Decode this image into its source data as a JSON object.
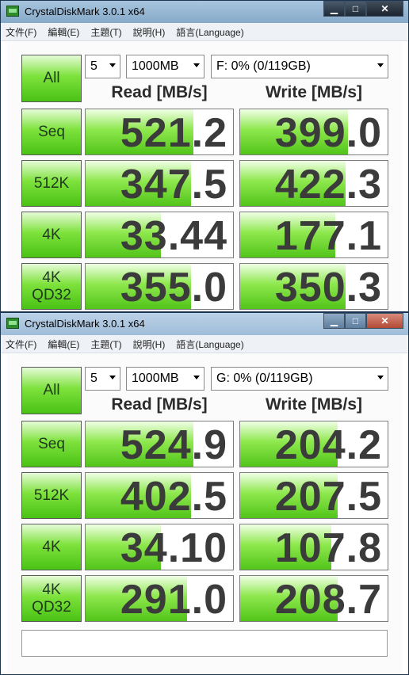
{
  "windows": [
    {
      "title": "CrystalDiskMark 3.0.1 x64",
      "menu": [
        "文件(F)",
        "編輯(E)",
        "主題(T)",
        "說明(H)",
        "語言(Language)"
      ],
      "all_label": "All",
      "count": "5",
      "size": "1000MB",
      "drive": "F: 0% (0/119GB)",
      "read_header": "Read [MB/s]",
      "write_header": "Write [MB/s]",
      "rows": [
        {
          "label": "Seq",
          "label2": "",
          "read": "521.2",
          "write": "399.0"
        },
        {
          "label": "512K",
          "label2": "",
          "read": "347.5",
          "write": "422.3"
        },
        {
          "label": "4K",
          "label2": "",
          "read": "33.44",
          "write": "177.1"
        },
        {
          "label": "4K",
          "label2": "QD32",
          "read": "355.0",
          "write": "350.3"
        }
      ]
    },
    {
      "title": "CrystalDiskMark 3.0.1 x64",
      "menu": [
        "文件(F)",
        "編輯(E)",
        "主題(T)",
        "說明(H)",
        "語言(Language)"
      ],
      "all_label": "All",
      "count": "5",
      "size": "1000MB",
      "drive": "G: 0% (0/119GB)",
      "read_header": "Read [MB/s]",
      "write_header": "Write [MB/s]",
      "rows": [
        {
          "label": "Seq",
          "label2": "",
          "read": "524.9",
          "write": "204.2"
        },
        {
          "label": "512K",
          "label2": "",
          "read": "402.5",
          "write": "207.5"
        },
        {
          "label": "4K",
          "label2": "",
          "read": "34.10",
          "write": "107.8"
        },
        {
          "label": "4K",
          "label2": "QD32",
          "read": "291.0",
          "write": "208.7"
        }
      ],
      "comment": ""
    }
  ],
  "icons": {
    "app": "disk-icon",
    "minimize": "minimize-icon",
    "maximize": "maximize-icon",
    "close": "close-icon",
    "dropdown": "chevron-down-icon"
  },
  "colors": {
    "accent": "#52c41a"
  }
}
